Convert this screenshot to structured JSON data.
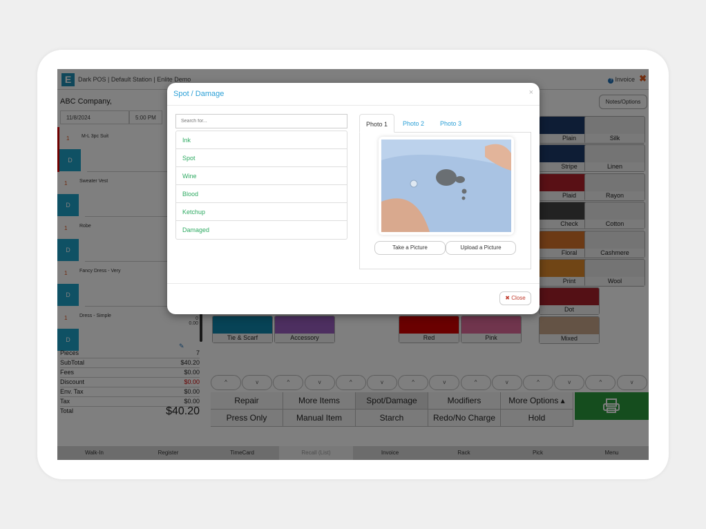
{
  "app": {
    "title": "Dark POS | Default Station | Enlite Demo",
    "logo_letter": "E",
    "invoice_link": "Invoice",
    "help_icon": "question-circle-icon",
    "close_icon": "x-icon"
  },
  "customer": {
    "name": "ABC Company,",
    "date": "11/8/2024",
    "time": "5:00 PM"
  },
  "notes_button": "Notes/Options",
  "order_items": [
    {
      "qty": "1",
      "name": "M-L 3pc Suit",
      "badge": "D",
      "selected": true
    },
    {
      "qty": "1",
      "name": "Sweater Vest",
      "badge": "D",
      "selected": false
    },
    {
      "qty": "1",
      "name": "Robe",
      "badge": "D",
      "selected": false
    },
    {
      "qty": "1",
      "name": "Fancy Dress - Very",
      "badge": "D",
      "selected": false
    },
    {
      "qty": "1",
      "name": "Dress - Simple",
      "badge": "D",
      "selected": false
    }
  ],
  "last_item_values": {
    "count": "0",
    "price": "0.00"
  },
  "totals": [
    {
      "label": "Pieces",
      "value": "7"
    },
    {
      "label": "SubTotal",
      "value": "$40.20"
    },
    {
      "label": "Fees",
      "value": "$0.00"
    },
    {
      "label": "Discount",
      "value": "$0.00"
    },
    {
      "label": "Env. Tax",
      "value": "$0.00"
    },
    {
      "label": "Tax",
      "value": "$0.00"
    },
    {
      "label": "Total",
      "value": "$40.20"
    }
  ],
  "fabric_tiles": [
    {
      "label": "Plain",
      "color": "#1d3a6b"
    },
    {
      "label": "Silk",
      "color": ""
    },
    {
      "label": "Stripe",
      "color": "#1d3a6b"
    },
    {
      "label": "Linen",
      "color": ""
    },
    {
      "label": "Plaid",
      "color": "#b3202a"
    },
    {
      "label": "Rayon",
      "color": ""
    },
    {
      "label": "Check",
      "color": "#444444"
    },
    {
      "label": "Cotton",
      "color": ""
    },
    {
      "label": "Floral",
      "color": "#d9742b"
    },
    {
      "label": "Cashmere",
      "color": ""
    },
    {
      "label": "Print",
      "color": "#e08a2a"
    },
    {
      "label": "Wool",
      "color": ""
    },
    {
      "label": "Dot",
      "color": "#a8202a"
    },
    {
      "label": "Mixed",
      "color": "#c9a68a"
    }
  ],
  "category_tiles": [
    {
      "label": "Tie & Scarf",
      "color": "#0f86ad"
    },
    {
      "label": "Accessory",
      "color": "#9b5fc0"
    }
  ],
  "color_tiles": [
    {
      "label": "Red",
      "color": "#d40000"
    },
    {
      "label": "Pink",
      "color": "#e06b9a"
    }
  ],
  "scroll_arrows": [
    "^",
    "v",
    "^",
    "v",
    "^",
    "v",
    "^",
    "v",
    "^",
    "v",
    "^",
    "v",
    "^",
    "v"
  ],
  "actions": {
    "row1": [
      "Repair",
      "More Items",
      "Spot/Damage",
      "Modifiers",
      "More Options ▴"
    ],
    "row2": [
      "Press Only",
      "Manual Item",
      "Starch",
      "Redo/No Charge",
      "Hold"
    ],
    "print_icon": "printer-icon",
    "print_color": "#2a9a3c"
  },
  "bottom_nav": [
    "Walk-In",
    "Register",
    "TimeCard",
    "Recall (List)",
    "Invoice",
    "Rack",
    "Pick",
    "Menu"
  ],
  "modal": {
    "title": "Spot / Damage",
    "close_x": "×",
    "search_placeholder": "Search for...",
    "options": [
      "Ink",
      "Spot",
      "Wine",
      "Blood",
      "Ketchup",
      "Damaged"
    ],
    "tabs": [
      "Photo 1",
      "Photo 2",
      "Photo 3"
    ],
    "active_tab": "Photo 1",
    "take_picture": "Take a Picture",
    "upload_picture": "Upload a Picture",
    "close_button": "✖ Close"
  }
}
